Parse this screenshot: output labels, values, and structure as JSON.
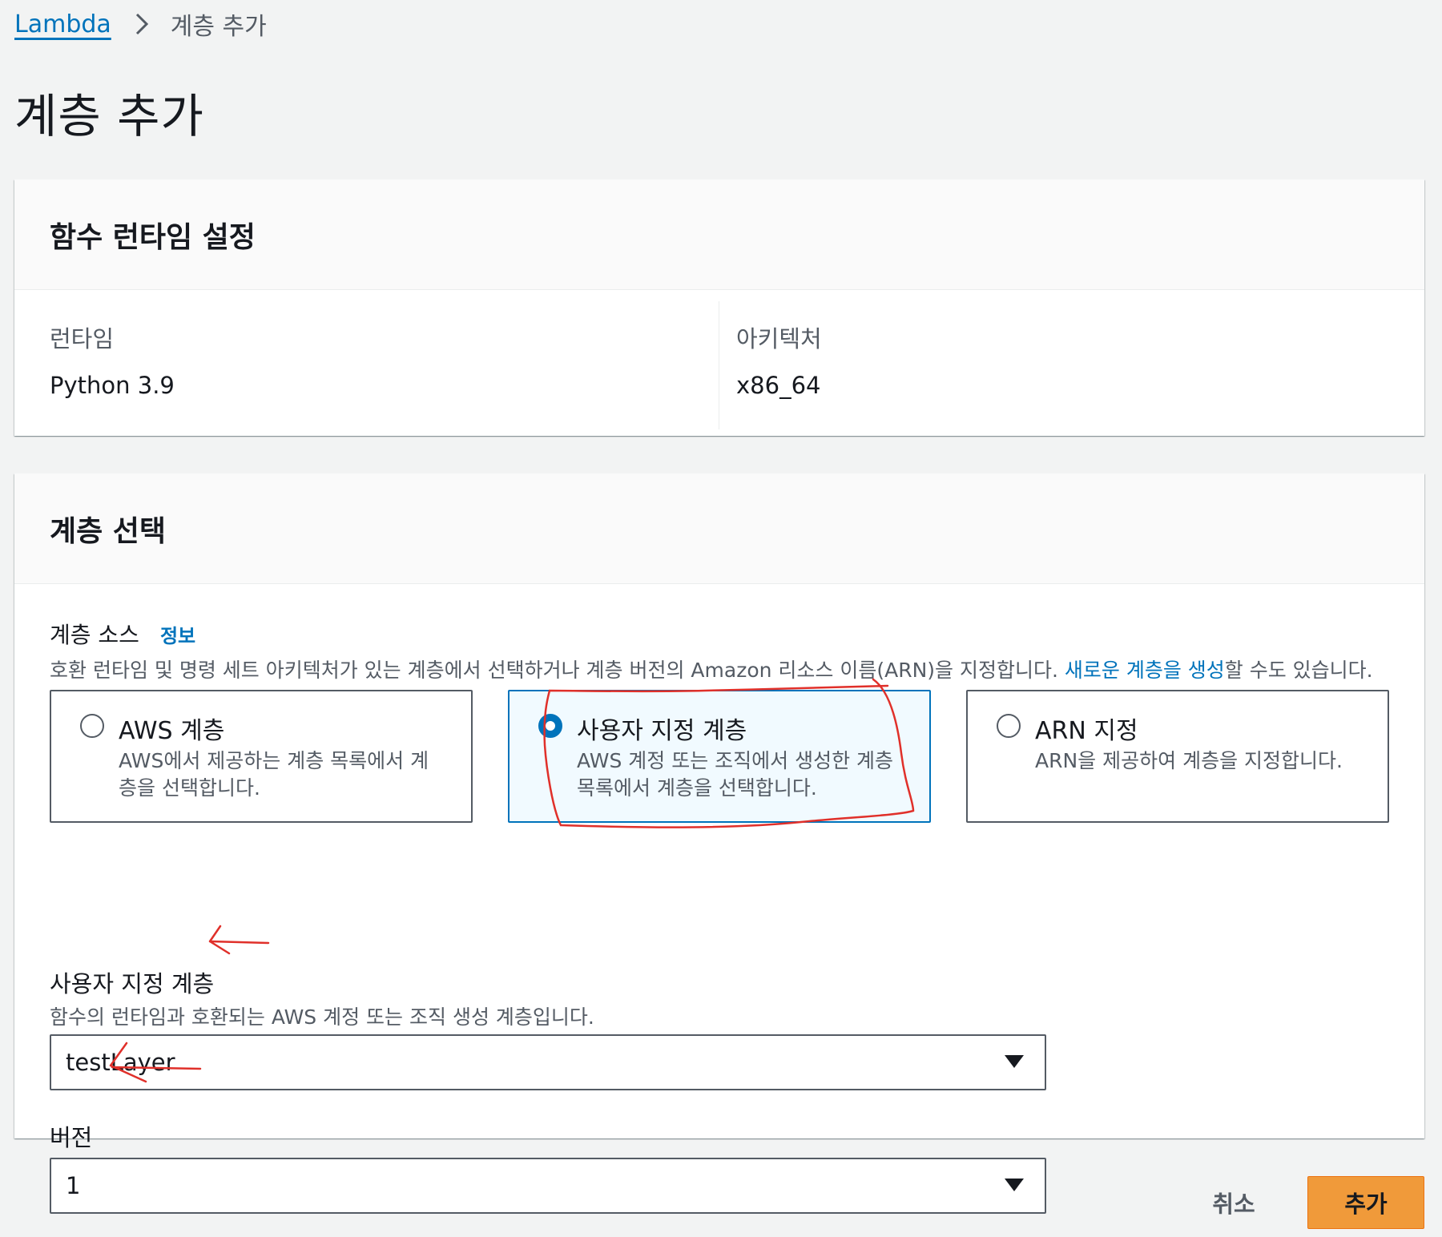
{
  "breadcrumb": {
    "root": "Lambda",
    "current": "계층 추가"
  },
  "page": {
    "title": "계층 추가"
  },
  "runtime_settings": {
    "heading": "함수 런타임 설정",
    "runtime_label": "런타임",
    "runtime_value": "Python 3.9",
    "architecture_label": "아키텍처",
    "architecture_value": "x86_64"
  },
  "layer_select": {
    "heading": "계층 선택",
    "source_label": "계층 소스",
    "info_link": "정보",
    "source_desc_before": "호환 런타임 및 명령 세트 아키텍처가 있는 계층에서 선택하거나 계층 버전의 Amazon 리소스 이름(ARN)을 지정합니다. ",
    "source_desc_link": "새로운 계층을 생성",
    "source_desc_after": "할 수도 있습니다.",
    "tiles": [
      {
        "title": "AWS 계층",
        "desc": "AWS에서 제공하는 계층 목록에서 계층을 선택합니다.",
        "selected": false
      },
      {
        "title": "사용자 지정 계층",
        "desc": "AWS 계정 또는 조직에서 생성한 계층 목록에서 계층을 선택합니다.",
        "selected": true
      },
      {
        "title": "ARN 지정",
        "desc": "ARN을 제공하여 계층을 지정합니다.",
        "selected": false
      }
    ],
    "custom_label": "사용자 지정 계층",
    "custom_desc": "함수의 런타임과 호환되는 AWS 계정 또는 조직 생성 계층입니다.",
    "custom_value": "testLayer",
    "version_label": "버전",
    "version_value": "1"
  },
  "actions": {
    "cancel": "취소",
    "add": "추가"
  },
  "colors": {
    "link": "#0073bb",
    "primary_button": "#f09a3a",
    "annotation": "#e0302a"
  }
}
